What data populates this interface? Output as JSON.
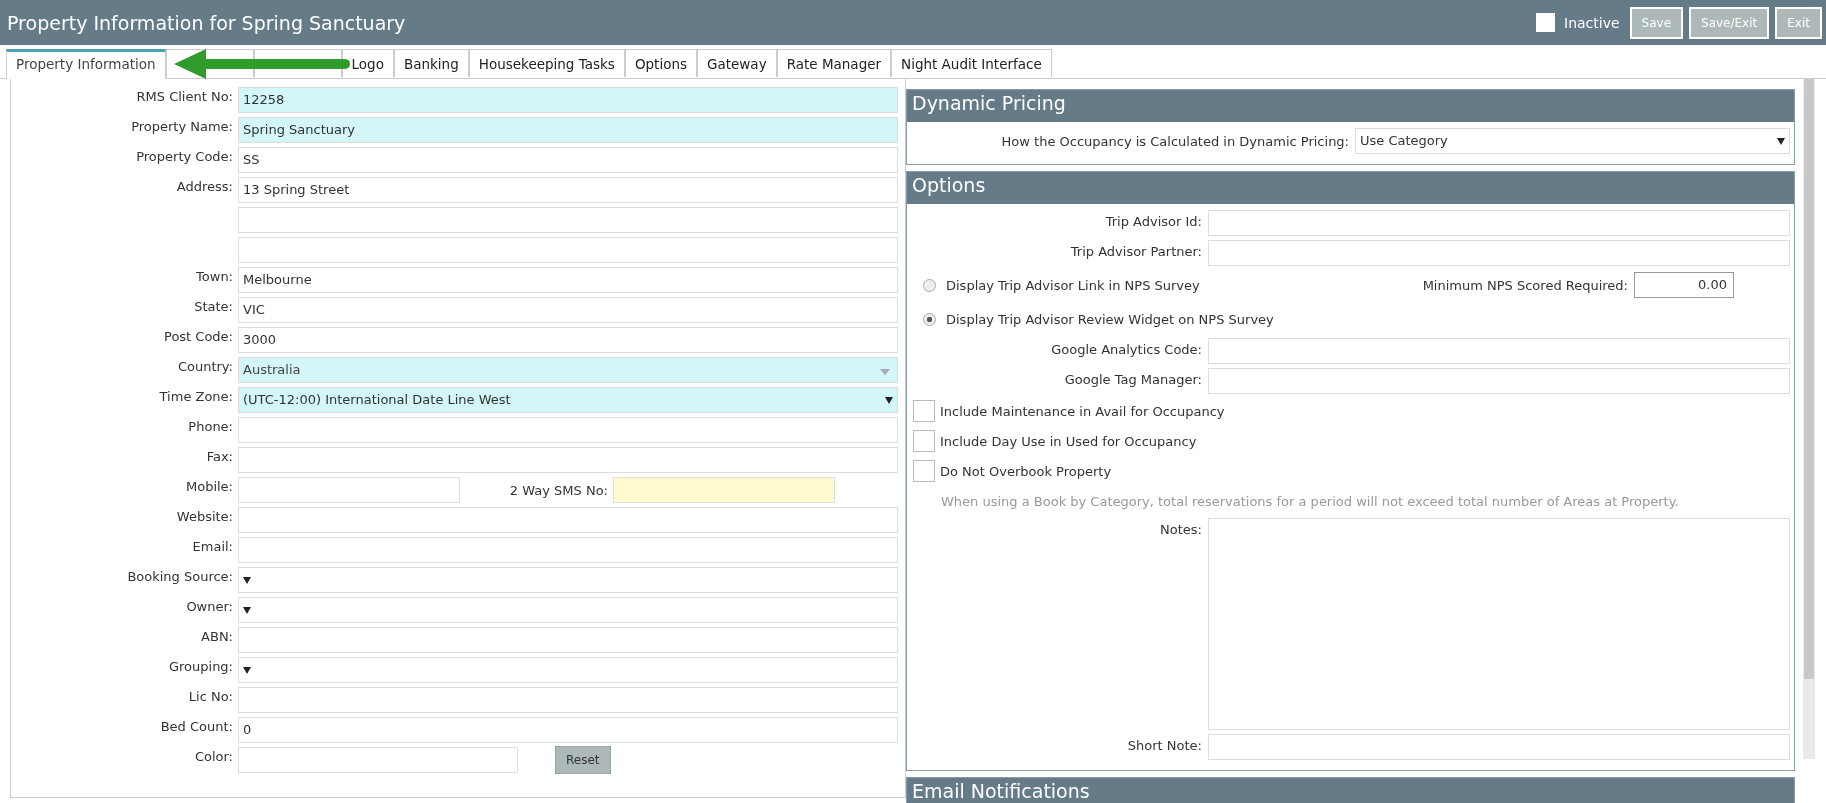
{
  "window": {
    "title": "Property Information for Spring Sanctuary",
    "inactive": {
      "label": "Inactive",
      "checked": false
    },
    "buttons": [
      "Save",
      "Save/Exit",
      "Exit"
    ]
  },
  "tabs": [
    {
      "label": "Property Information",
      "selected": true
    },
    {
      "label": "Logo",
      "selected": false
    },
    {
      "label": "Banking",
      "selected": false
    },
    {
      "label": "Housekeeping Tasks",
      "selected": false
    },
    {
      "label": "Options",
      "selected": false
    },
    {
      "label": "Gateway",
      "selected": false
    },
    {
      "label": "Rate Manager",
      "selected": false
    },
    {
      "label": "Night Audit Interface",
      "selected": false
    }
  ],
  "property_form": [
    {
      "kind": "text",
      "label": "RMS Client No:",
      "value": "12258",
      "color": "#d3f6f9"
    },
    {
      "kind": "text",
      "label": "Property Name:",
      "value": "Spring Sanctuary",
      "color": "#d3f6f9"
    },
    {
      "kind": "text",
      "label": "Property Code:",
      "value": "SS"
    },
    {
      "kind": "text",
      "label": "Address:",
      "value": "13 Spring Street"
    },
    {
      "kind": "text"
    },
    {
      "kind": "text"
    },
    {
      "kind": "text",
      "label": "Town:",
      "value": "Melbourne"
    },
    {
      "kind": "text",
      "label": "State:",
      "value": "VIC"
    },
    {
      "kind": "text",
      "label": "Post Code:",
      "value": "3000"
    },
    {
      "kind": "select",
      "label": "Country:",
      "value": "Australia",
      "color": "#d3f6f9",
      "disabled": true
    },
    {
      "kind": "select",
      "label": "Time Zone:",
      "value": "(UTC-12:00) International Date Line West",
      "color": "#d3f6f9",
      "disabled": false
    },
    {
      "kind": "text",
      "label": "Phone:"
    },
    {
      "kind": "text",
      "label": "Fax:"
    },
    {
      "kind": "pair",
      "label": "Mobile:",
      "second": {
        "label": "2 Way SMS No:",
        "color": "#fffacd"
      }
    },
    {
      "kind": "text",
      "label": "Website:"
    },
    {
      "kind": "text",
      "label": "Email:"
    },
    {
      "kind": "select",
      "label": "Booking Source:",
      "disabled": false
    },
    {
      "kind": "select",
      "label": "Owner:",
      "disabled": false
    },
    {
      "kind": "text",
      "label": "ABN:"
    },
    {
      "kind": "select",
      "label": "Grouping:",
      "disabled": false
    },
    {
      "kind": "text",
      "label": "Lic No:"
    },
    {
      "kind": "text",
      "label": "Bed Count:",
      "value": "0"
    },
    {
      "kind": "color",
      "label": "Color:",
      "button": "Reset"
    }
  ],
  "dynamic_pricing": {
    "title": "Dynamic Pricing",
    "label": "How the Occupancy is Calculated in Dynamic Pricing:",
    "value": "Use Category"
  },
  "options": {
    "title": "Options",
    "items": [
      {
        "kind": "field",
        "label": "Trip Advisor Id:"
      },
      {
        "kind": "field",
        "label": "Trip Advisor Partner:"
      },
      {
        "kind": "radio",
        "label": "Display Trip Advisor Link in NPS Survey",
        "selected": false,
        "side_label": "Minimum NPS Scored Required:",
        "side_value": "0.00"
      },
      {
        "kind": "radio",
        "label": "Display Trip Advisor Review Widget on NPS Survey",
        "selected": true
      },
      {
        "kind": "field",
        "label": "Google Analytics Code:"
      },
      {
        "kind": "field",
        "label": "Google Tag Manager:"
      },
      {
        "kind": "checkbox",
        "label": "Include Maintenance in Avail for Occupancy",
        "checked": false
      },
      {
        "kind": "checkbox",
        "label": "Include Day Use in Used for Occupancy",
        "checked": false
      },
      {
        "kind": "checkbox",
        "label": "Do Not Overbook Property",
        "checked": false
      },
      {
        "kind": "hint",
        "text": "When using a Book by Category, total reservations for a period will not exceed total number of Areas at Property."
      },
      {
        "kind": "textarea",
        "label": "Notes:"
      },
      {
        "kind": "field",
        "label": "Short Note:"
      }
    ]
  },
  "email_notifications": {
    "title": "Email Notifications"
  }
}
